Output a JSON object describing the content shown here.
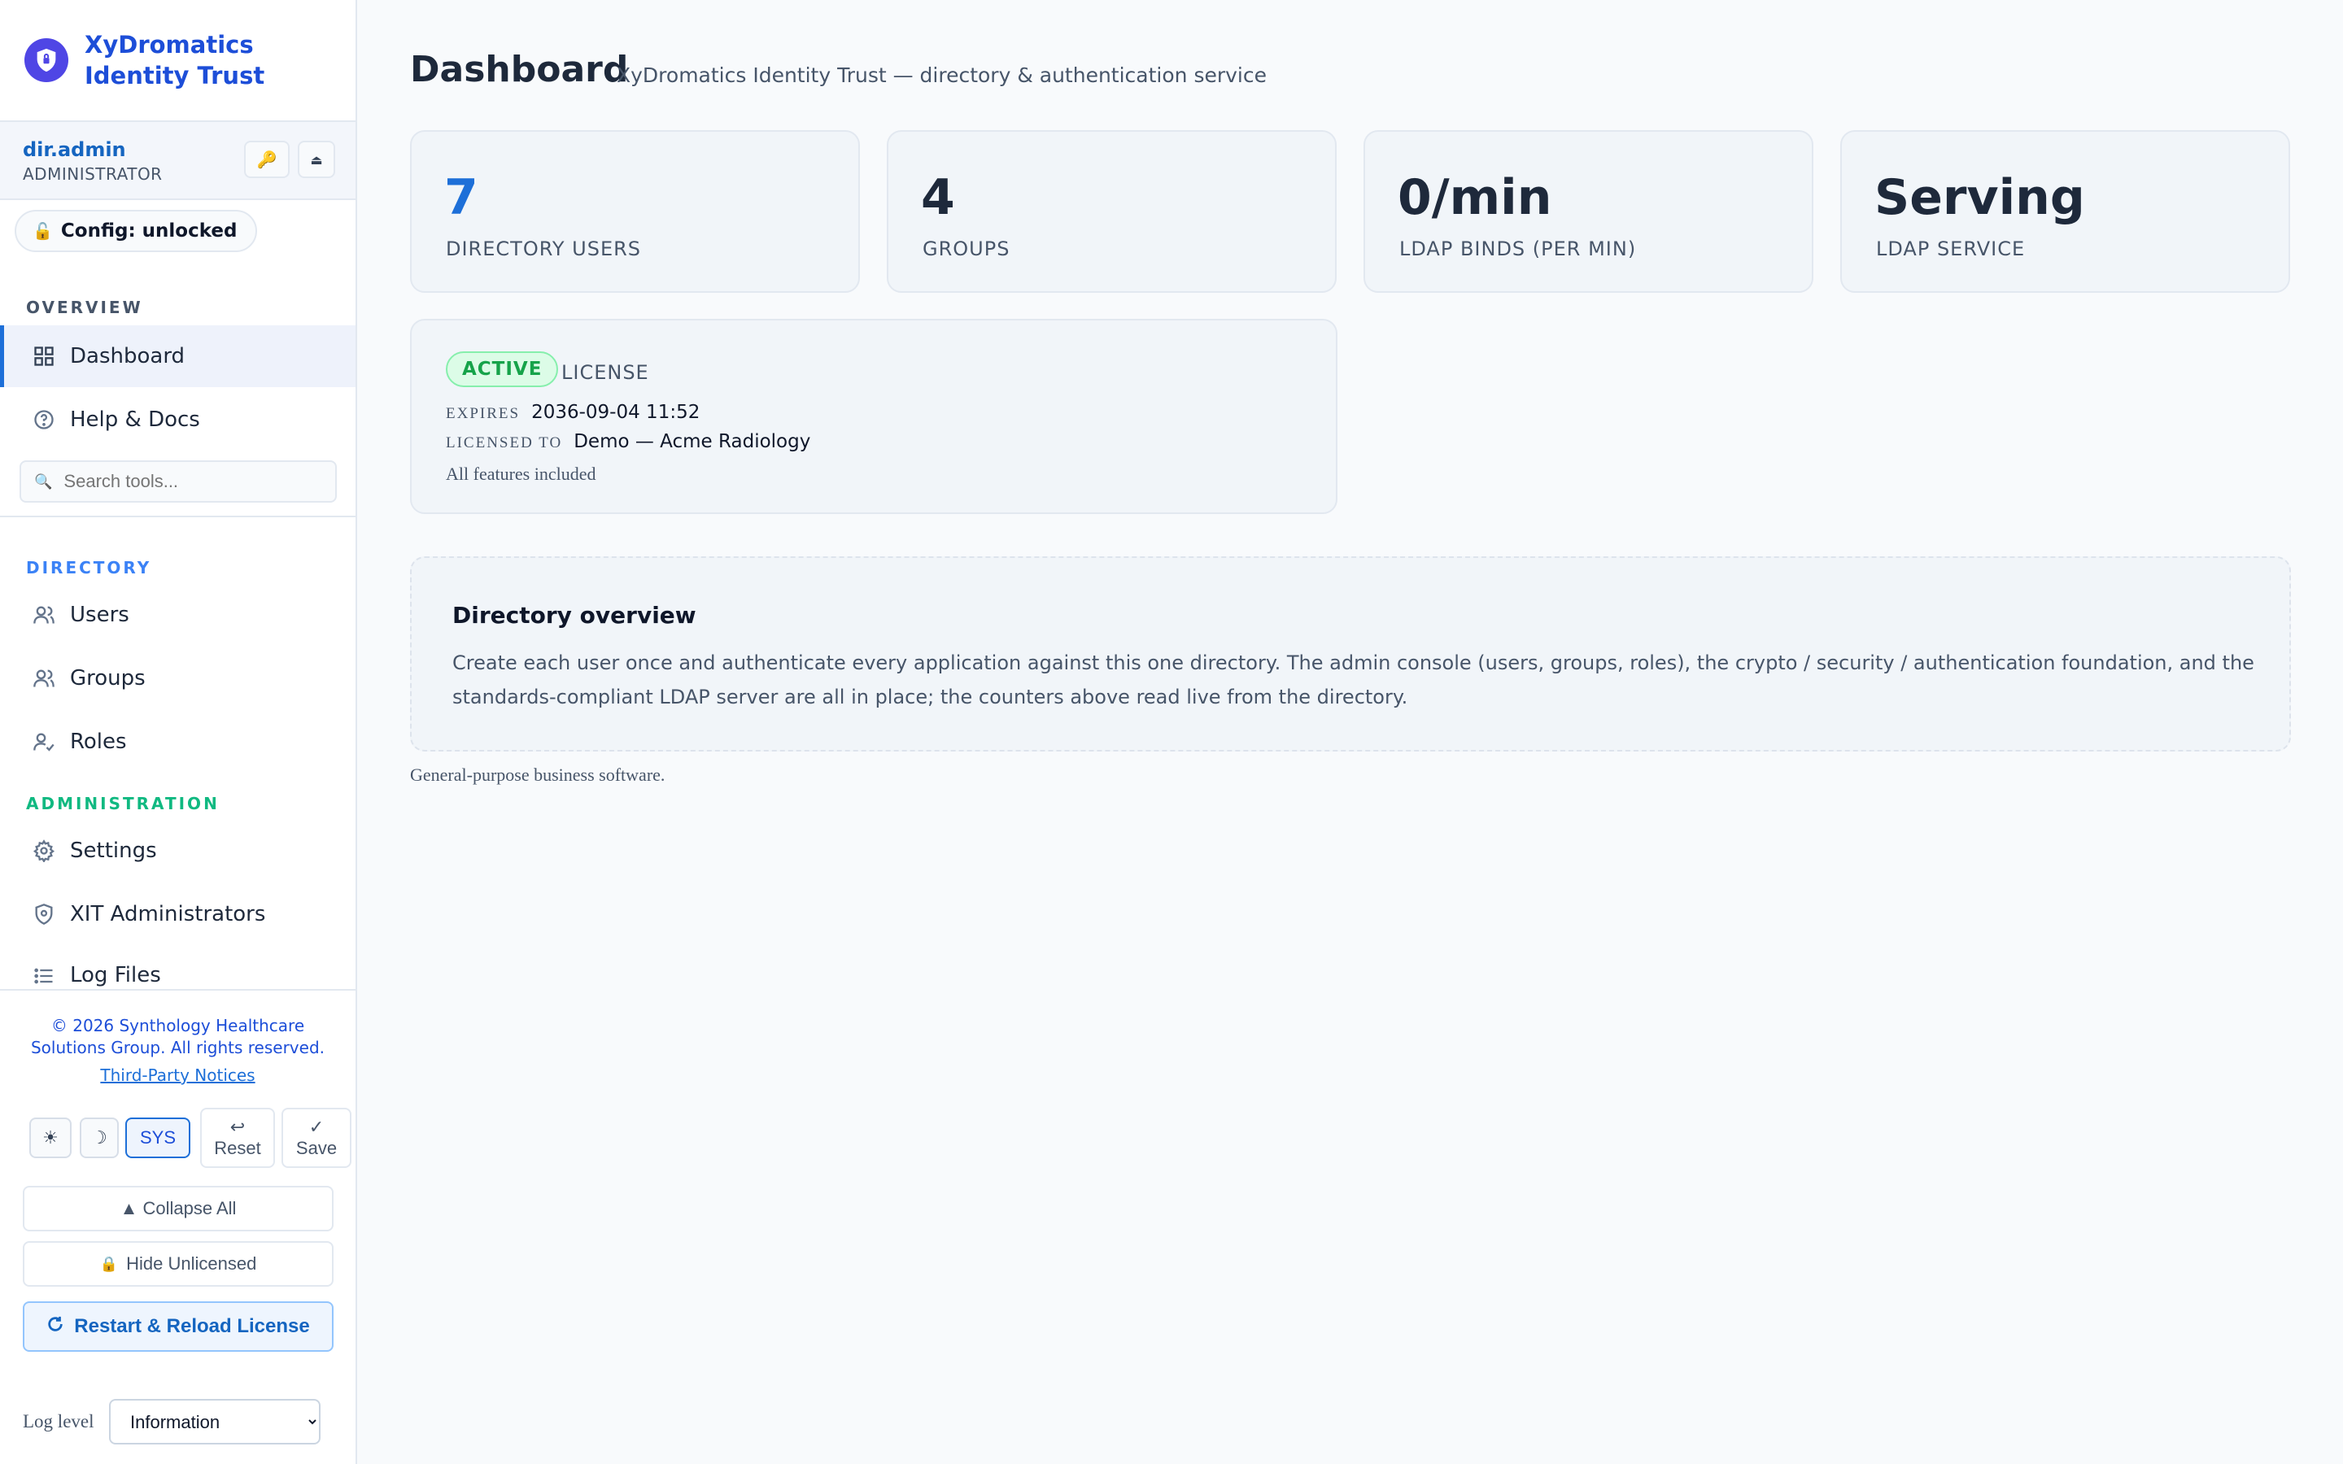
{
  "brand": {
    "title": "XyDromatics Identity Trust"
  },
  "user": {
    "name": "dir.admin",
    "role": "ADMINISTRATOR",
    "key_icon": "key-icon",
    "collapse_icon": "eject-icon"
  },
  "config": {
    "label": "Config: unlocked",
    "icon": "unlock-icon"
  },
  "nav": {
    "overview_label": "OVERVIEW",
    "dashboard": "Dashboard",
    "help": "Help & Docs",
    "search_placeholder": "Search tools...",
    "directory_label": "DIRECTORY",
    "users": "Users",
    "groups": "Groups",
    "roles": "Roles",
    "administration_label": "ADMINISTRATION",
    "settings": "Settings",
    "xit_admins": "XIT Administrators",
    "log_files": "Log Files"
  },
  "sidebar_footer": {
    "copyright": "© 2026 Synthology Healthcare Solutions Group. All rights reserved.",
    "third_party": "Third-Party Notices",
    "theme_light": "☀",
    "theme_dark": "☽",
    "theme_sys": "SYS",
    "reset_icon": "↩",
    "reset_label": "Reset",
    "save_icon": "✓",
    "save_label": "Save",
    "collapse_all": "▲ Collapse All",
    "hide_unlicensed": "Hide Unlicensed",
    "restart": "Restart & Reload License",
    "log_level_label": "Log level",
    "log_level_value": "Information"
  },
  "header": {
    "title": "Dashboard",
    "subtitle": "XyDromatics Identity Trust — directory & authentication service"
  },
  "stats": [
    {
      "value": "7",
      "label": "DIRECTORY USERS"
    },
    {
      "value": "4",
      "label": "GROUPS"
    },
    {
      "value": "0/min",
      "label": "LDAP BINDS (PER MIN)"
    },
    {
      "value": "Serving",
      "label": "LDAP SERVICE"
    }
  ],
  "license": {
    "status": "ACTIVE",
    "title": "LICENSE",
    "expires_key": "EXPIRES",
    "expires_value": "2036-09-04 11:52",
    "licensed_key": "LICENSED TO",
    "licensed_value": "Demo — Acme Radiology",
    "note": "All features included"
  },
  "overview": {
    "title": "Directory overview",
    "body": "Create each user once and authenticate every application against this one directory. The admin console (users, groups, roles), the crypto / security / authentication foundation, and the standards-compliant LDAP server are all in place; the counters above read live from the directory."
  },
  "footer_note": "General-purpose business software.",
  "colors": {
    "accent": "#1d6fd8",
    "brand_logo": "#4f46e5",
    "directory_section": "#3b82f6",
    "administration_section": "#10b981",
    "active_badge": "#16a34a"
  }
}
